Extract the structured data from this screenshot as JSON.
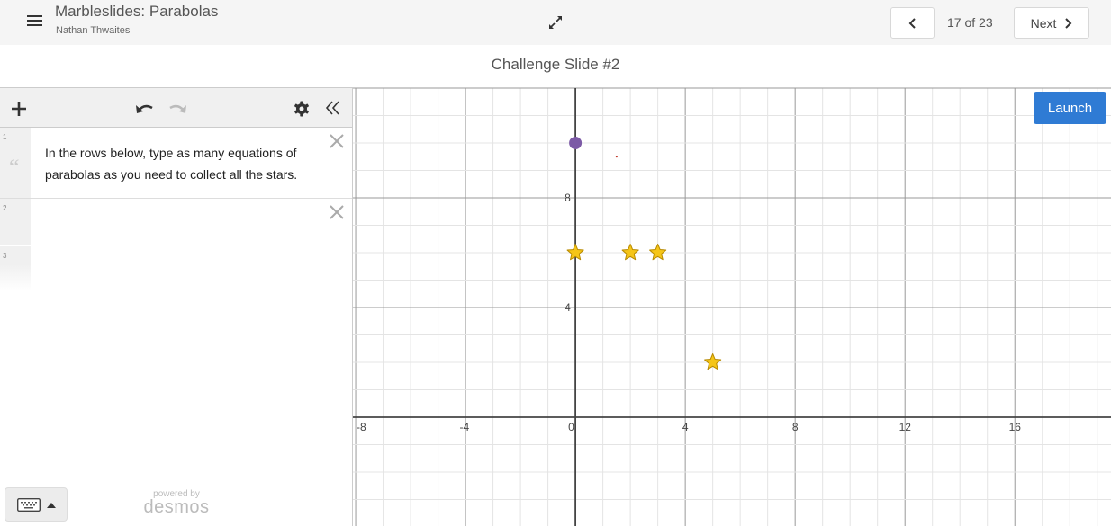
{
  "header": {
    "activity_title": "Marbleslides: Parabolas",
    "author": "Nathan Thwaites",
    "menu_icon": "hamburger-menu-icon",
    "expand_icon": "expand-arrows-icon",
    "prev_icon": "chevron-left-icon",
    "page_indicator": "17 of 23",
    "next_label": "Next",
    "next_icon": "chevron-right-icon"
  },
  "slide": {
    "title": "Challenge Slide #2"
  },
  "expression_panel": {
    "toolbar": {
      "add_icon": "plus-icon",
      "undo_icon": "undo-icon",
      "redo_icon": "redo-icon",
      "settings_icon": "gear-icon",
      "collapse_icon": "double-chevron-left-icon"
    },
    "rows": [
      {
        "number": "1",
        "type": "note",
        "text": "In the rows below, type as many equations of parabolas as you need to collect all the stars.",
        "quote_glyph": "“"
      },
      {
        "number": "2",
        "type": "expression",
        "text": ""
      },
      {
        "number": "3",
        "type": "expression",
        "text": ""
      }
    ],
    "keypad_icon": "keyboard-icon",
    "powered_by": "powered by",
    "brand": "desmos"
  },
  "graph": {
    "launch_label": "Launch",
    "colors": {
      "marble": "#7c5aa6",
      "star_fill": "#f5c518",
      "star_stroke": "#b88a00",
      "launch": "#2f7bd4",
      "target_dot": "#c0392b"
    }
  },
  "chart_data": {
    "type": "scatter",
    "title": "",
    "xlabel": "",
    "ylabel": "",
    "xlim": [
      -8.1,
      19.5
    ],
    "ylim": [
      -4.0,
      12.0
    ],
    "grid": true,
    "minor_step": 1,
    "major_step": 4,
    "x_tick_labels": [
      "-8",
      "-4",
      "0",
      "4",
      "8",
      "12",
      "16"
    ],
    "x_ticks": [
      -8,
      -4,
      0,
      4,
      8,
      12,
      16
    ],
    "y_tick_labels": [
      "4",
      "8"
    ],
    "y_ticks": [
      4,
      8
    ],
    "series": [
      {
        "name": "marble",
        "marker": "circle",
        "points": [
          [
            0,
            10
          ]
        ]
      },
      {
        "name": "stars",
        "marker": "star",
        "points": [
          [
            0,
            6
          ],
          [
            2,
            6
          ],
          [
            3,
            6
          ],
          [
            5,
            2
          ]
        ]
      },
      {
        "name": "dot",
        "marker": "dot",
        "points": [
          [
            1.5,
            9.5
          ]
        ]
      }
    ]
  }
}
